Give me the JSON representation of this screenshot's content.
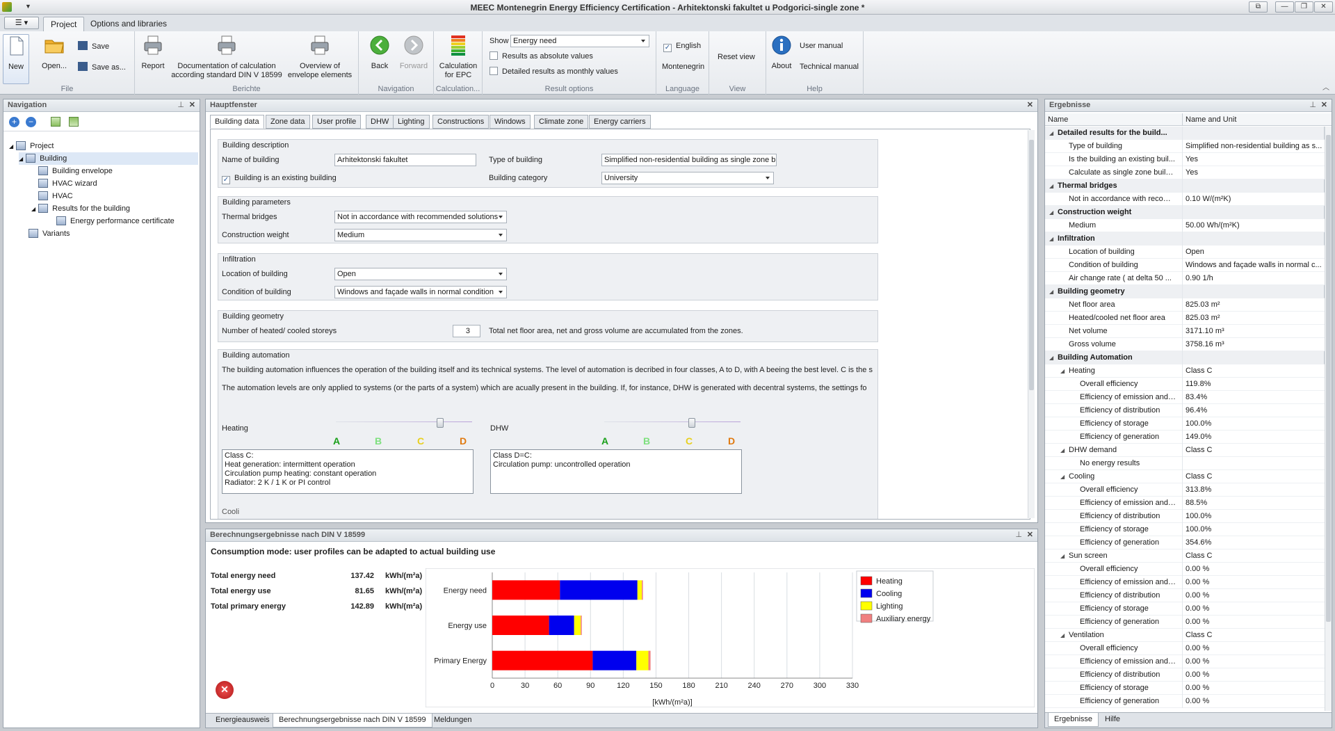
{
  "window": {
    "title": "MEEC Montenegrin Energy Efficiency Certification - Arhitektonski fakultet u Podgorici-single zone *"
  },
  "ribbon": {
    "tabs": [
      "Project",
      "Options and libraries"
    ],
    "file": {
      "new": "New",
      "open": "Open...",
      "save": "Save",
      "save_as": "Save as...",
      "caption": "File"
    },
    "berichte": {
      "report": "Report",
      "doc_calc": "Documentation of calculation according standard DIN V 18599",
      "overview": "Overview of envelope elements",
      "caption": "Berichte"
    },
    "navigation": {
      "back": "Back",
      "forward": "Forward",
      "caption": "Navigation"
    },
    "calculation": {
      "epc": "Calculation for EPC",
      "caption": "Calculation..."
    },
    "result_options": {
      "show_label": "Show",
      "show_value": "Energy need",
      "absolute": "Results as absolute values",
      "monthly": "Detailed results as monthly values",
      "caption": "Result options"
    },
    "language": {
      "english": "English",
      "montenegrin": "Montenegrin",
      "caption": "Language"
    },
    "view": {
      "reset": "Reset view",
      "caption": "View"
    },
    "help": {
      "about": "About",
      "user_manual": "User manual",
      "technical_manual": "Technical manual",
      "caption": "Help"
    }
  },
  "navigation": {
    "title": "Navigation",
    "tree": [
      "Project",
      "Building",
      "Building envelope",
      "HVAC wizard",
      "HVAC",
      "Results for the building",
      "Energy performance certificate",
      "Variants"
    ]
  },
  "main": {
    "title": "Hauptfenster",
    "tabs": [
      "Building data",
      "Zone data",
      "User profile",
      "DHW",
      "Lighting",
      "Constructions",
      "Windows",
      "Climate zone",
      "Energy carriers"
    ],
    "description": {
      "title": "Building description",
      "name_label": "Name of building",
      "name_value": "Arhitektonski fakultet",
      "type_label": "Type of building",
      "type_value": "Simplified non-residential building as single zone building",
      "existing_label": "Building is an existing building",
      "category_label": "Building category",
      "category_value": "University"
    },
    "parameters": {
      "title": "Building parameters",
      "thermal_label": "Thermal bridges",
      "thermal_value": "Not in accordance with recommended solutions",
      "weight_label": "Construction weight",
      "weight_value": "Medium"
    },
    "infiltration": {
      "title": "Infiltration",
      "location_label": "Location of building",
      "location_value": "Open",
      "condition_label": "Condition of building",
      "condition_value": "Windows and façade walls in normal condition"
    },
    "geometry": {
      "title": "Building geometry",
      "storeys_label": "Number of heated/ cooled storeys",
      "storeys_value": "3",
      "note": "Total net floor area, net and gross volume  are accumulated from the zones."
    },
    "automation": {
      "title": "Building automation",
      "text1": "The building automation influences the operation of the building itself and its technical systems. The level of automation is decribed in four classes, A to D, with A beeing the best level. C is the s",
      "text2": "The automation levels are only applied to systems (or the parts of a system) which are acually present in the building. If, for instance, DHW is generated with decentral systems, the settings fo",
      "heating_label": "Heating",
      "dhw_label": "DHW",
      "classes": [
        "A",
        "B",
        "C",
        "D"
      ],
      "class_colors": [
        "#1aa01a",
        "#7ee07e",
        "#e8d020",
        "#e07a10"
      ],
      "heating_level": "C",
      "dhw_level": "C",
      "heating_text": "Class C:\nHeat generation: intermittent operation\nCirculation pump heating: constant operation\nRadiator: 2 K / 1 K or PI control",
      "dhw_text": "Class D=C:\nCirculation pump: uncontrolled operation",
      "cooling_cut": "Cooli"
    }
  },
  "calc_results": {
    "title": "Berechnungsergebnisse nach DIN V 18599",
    "mode": "Consumption mode: user profiles can be adapted to actual building use",
    "rows": [
      {
        "label": "Total energy need",
        "value": "137.42",
        "unit": "kWh/(m²a)"
      },
      {
        "label": "Total energy use",
        "value": "81.65",
        "unit": "kWh/(m²a)"
      },
      {
        "label": "Total primary energy",
        "value": "142.89",
        "unit": "kWh/(m²a)"
      }
    ],
    "bottom_tabs": [
      "Energieausweis",
      "Berechnungsergebnisse nach DIN V 18599",
      "Meldungen"
    ]
  },
  "chart_data": {
    "type": "bar",
    "orientation": "horizontal",
    "stacked": true,
    "categories": [
      "Energy need",
      "Energy use",
      "Primary Energy"
    ],
    "series": [
      {
        "name": "Heating",
        "color": "#ff0000",
        "values": [
          62,
          52,
          92
        ]
      },
      {
        "name": "Cooling",
        "color": "#0000ee",
        "values": [
          71,
          23,
          40
        ]
      },
      {
        "name": "Lighting",
        "color": "#ffff00",
        "values": [
          4,
          6,
          11
        ]
      },
      {
        "name": "Auxiliary energy",
        "color": "#f08080",
        "values": [
          1,
          1,
          2
        ]
      }
    ],
    "xlabel": "[kWh/(m²a)]",
    "xlim": [
      0,
      330
    ],
    "xticks": [
      "0",
      "30",
      "60",
      "90",
      "120",
      "150",
      "180",
      "210",
      "240",
      "270",
      "300",
      "330"
    ],
    "grid": true,
    "legend": "right"
  },
  "results_panel": {
    "title": "Ergebnisse",
    "col_name": "Name",
    "col_value": "Name and Unit",
    "rows": [
      {
        "n": "Detailed results for the build...",
        "v": "",
        "lvl": 0,
        "g": true
      },
      {
        "n": "Type of building",
        "v": "Simplified non-residential building as s...",
        "lvl": 1
      },
      {
        "n": "Is the building an existing buil...",
        "v": "Yes",
        "lvl": 1
      },
      {
        "n": "Calculate as single zone buildi...",
        "v": "Yes",
        "lvl": 1
      },
      {
        "n": "Thermal bridges",
        "v": "",
        "lvl": 0,
        "g": true
      },
      {
        "n": "Not in accordance with recom...",
        "v": "0.10 W/(m²K)",
        "lvl": 1
      },
      {
        "n": "Construction weight",
        "v": "",
        "lvl": 0,
        "g": true
      },
      {
        "n": "Medium",
        "v": "50.00 Wh/(m²K)",
        "lvl": 1
      },
      {
        "n": "Infiltration",
        "v": "",
        "lvl": 0,
        "g": true
      },
      {
        "n": "Location of building",
        "v": "Open",
        "lvl": 1
      },
      {
        "n": "Condition of building",
        "v": "Windows and façade walls in normal c...",
        "lvl": 1
      },
      {
        "n": "Air change rate ( at delta 50 ...",
        "v": "0.90 1/h",
        "lvl": 1
      },
      {
        "n": "Building geometry",
        "v": "",
        "lvl": 0,
        "g": true
      },
      {
        "n": "Net floor area",
        "v": "825.03 m²",
        "lvl": 1
      },
      {
        "n": "Heated/cooled net floor area",
        "v": "825.03 m²",
        "lvl": 1
      },
      {
        "n": "Net volume",
        "v": "3171.10 m³",
        "lvl": 1
      },
      {
        "n": "Gross volume",
        "v": "3758.16 m³",
        "lvl": 1
      },
      {
        "n": "Building Automation",
        "v": "",
        "lvl": 0,
        "g": true
      },
      {
        "n": "Heating",
        "v": "Class C",
        "lvl": 1
      },
      {
        "n": "Overall efficiency",
        "v": "119.8%",
        "lvl": 2
      },
      {
        "n": "Efficiency of emission and ...",
        "v": "83.4%",
        "lvl": 2
      },
      {
        "n": "Efficiency of distribution",
        "v": "96.4%",
        "lvl": 2
      },
      {
        "n": "Efficiency of storage",
        "v": "100.0%",
        "lvl": 2
      },
      {
        "n": "Efficiency of generation",
        "v": "149.0%",
        "lvl": 2
      },
      {
        "n": "DHW demand",
        "v": "Class C",
        "lvl": 1
      },
      {
        "n": "No energy results",
        "v": "",
        "lvl": 2
      },
      {
        "n": "Cooling",
        "v": "Class C",
        "lvl": 1
      },
      {
        "n": "Overall efficiency",
        "v": "313.8%",
        "lvl": 2
      },
      {
        "n": "Efficiency of emission and ...",
        "v": "88.5%",
        "lvl": 2
      },
      {
        "n": "Efficiency of distribution",
        "v": "100.0%",
        "lvl": 2
      },
      {
        "n": "Efficiency of storage",
        "v": "100.0%",
        "lvl": 2
      },
      {
        "n": "Efficiency of generation",
        "v": "354.6%",
        "lvl": 2
      },
      {
        "n": "Sun screen",
        "v": "Class C",
        "lvl": 1
      },
      {
        "n": "Overall efficiency",
        "v": "0.00 %",
        "lvl": 2
      },
      {
        "n": "Efficiency of emission and ...",
        "v": "0.00 %",
        "lvl": 2
      },
      {
        "n": "Efficiency of distribution",
        "v": "0.00 %",
        "lvl": 2
      },
      {
        "n": "Efficiency of storage",
        "v": "0.00 %",
        "lvl": 2
      },
      {
        "n": "Efficiency of generation",
        "v": "0.00 %",
        "lvl": 2
      },
      {
        "n": "Ventilation",
        "v": "Class C",
        "lvl": 1
      },
      {
        "n": "Overall efficiency",
        "v": "0.00 %",
        "lvl": 2
      },
      {
        "n": "Efficiency of emission and ...",
        "v": "0.00 %",
        "lvl": 2
      },
      {
        "n": "Efficiency of distribution",
        "v": "0.00 %",
        "lvl": 2
      },
      {
        "n": "Efficiency of storage",
        "v": "0.00 %",
        "lvl": 2
      },
      {
        "n": "Efficiency of generation",
        "v": "0.00 %",
        "lvl": 2
      }
    ],
    "bottom_tabs": [
      "Ergebnisse",
      "Hilfe"
    ]
  }
}
